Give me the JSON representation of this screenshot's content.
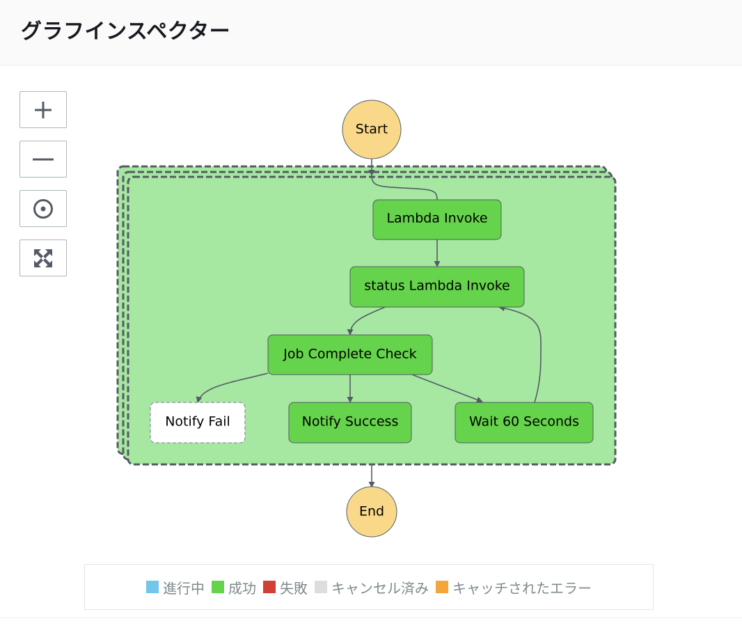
{
  "header": {
    "title": "グラフインスペクター"
  },
  "controls": [
    {
      "name": "zoom-in",
      "icon": "plus-icon"
    },
    {
      "name": "zoom-out",
      "icon": "minus-icon"
    },
    {
      "name": "center",
      "icon": "target-icon"
    },
    {
      "name": "fit",
      "icon": "expand-arrows-icon"
    }
  ],
  "graph": {
    "start": {
      "label": "Start"
    },
    "end": {
      "label": "End"
    },
    "map_state": {
      "status": "success",
      "style": "stacked-dashed"
    },
    "nodes": [
      {
        "id": "lambda-invoke",
        "label": "Lambda Invoke",
        "status": "success"
      },
      {
        "id": "status-lambda-invoke",
        "label": "status Lambda Invoke",
        "status": "success"
      },
      {
        "id": "job-complete-check",
        "label": "Job Complete Check",
        "status": "success"
      },
      {
        "id": "notify-fail",
        "label": "Notify Fail",
        "status": "not-run"
      },
      {
        "id": "notify-success",
        "label": "Notify Success",
        "status": "success"
      },
      {
        "id": "wait-60-seconds",
        "label": "Wait 60 Seconds",
        "status": "success"
      }
    ],
    "edges": [
      {
        "from": "start",
        "to": "lambda-invoke"
      },
      {
        "from": "lambda-invoke",
        "to": "status-lambda-invoke"
      },
      {
        "from": "status-lambda-invoke",
        "to": "job-complete-check"
      },
      {
        "from": "job-complete-check",
        "to": "notify-fail"
      },
      {
        "from": "job-complete-check",
        "to": "notify-success"
      },
      {
        "from": "job-complete-check",
        "to": "wait-60-seconds"
      },
      {
        "from": "wait-60-seconds",
        "to": "status-lambda-invoke"
      },
      {
        "from": "map-state",
        "to": "end"
      }
    ]
  },
  "colors": {
    "success": "#65d34c",
    "map_fill": "#a6e8a1",
    "terminal": "#f9d989",
    "in_progress": "#72c6e9",
    "failed": "#d13f35",
    "cancelled": "#dddddd",
    "caught_error": "#f3a73a",
    "edge": "#545b64"
  },
  "legend": [
    {
      "label": "進行中",
      "color": "#72c6e9"
    },
    {
      "label": "成功",
      "color": "#65d34c"
    },
    {
      "label": "失敗",
      "color": "#d13f35"
    },
    {
      "label": "キャンセル済み",
      "color": "#dddddd"
    },
    {
      "label": "キャッチされたエラー",
      "color": "#f3a73a"
    }
  ]
}
